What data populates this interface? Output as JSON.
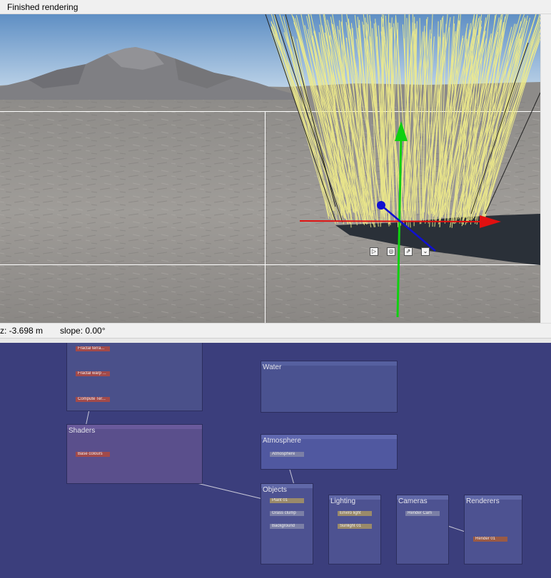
{
  "window": {
    "status_title": "Finished rendering"
  },
  "statusbar": {
    "z": "z: -3.698 m",
    "slope": "slope: 0.00°"
  },
  "viewport": {
    "gizmo_buttons": [
      {
        "icon": "move-snap-icon",
        "glyph": "▷"
      },
      {
        "icon": "center-icon",
        "glyph": "◎"
      },
      {
        "icon": "expand-icon",
        "glyph": "⇗"
      },
      {
        "icon": "drop-down-icon",
        "glyph": "⌄"
      }
    ],
    "colors": {
      "x_axis": "#e01010",
      "y_axis": "#10d010",
      "z_axis": "#1010d0",
      "grass": "#f0ec8a"
    }
  },
  "graph": {
    "groups": {
      "terrain": {
        "nodes": [
          "Fractal terra...",
          "Fractal warp ...",
          "Compute Ter..."
        ]
      },
      "shaders": {
        "label": "Shaders",
        "nodes": [
          "Base colours"
        ]
      },
      "water": {
        "label": "Water"
      },
      "atmosphere": {
        "label": "Atmosphere",
        "nodes": [
          "Atmosphere"
        ]
      },
      "objects": {
        "label": "Objects",
        "nodes": [
          "Plant 01",
          "Grass clump",
          "Background"
        ]
      },
      "lighting": {
        "label": "Lighting",
        "nodes": [
          "Enviro light",
          "Sunlight 01"
        ]
      },
      "cameras": {
        "label": "Cameras",
        "nodes": [
          "Render Cam"
        ]
      },
      "renderers": {
        "label": "Renderers",
        "nodes": [
          "Render 01"
        ]
      }
    }
  }
}
